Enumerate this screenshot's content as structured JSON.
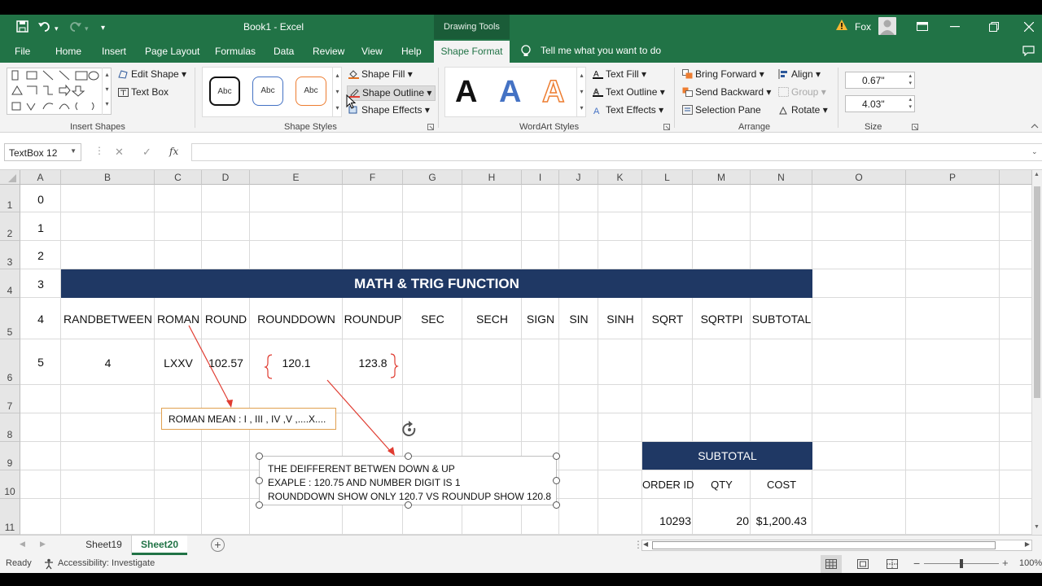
{
  "titlebar": {
    "title": "Book1  -  Excel",
    "contextual_group": "Drawing Tools",
    "user": "Fox",
    "customize_icon": "▾"
  },
  "tabs": {
    "file": "File",
    "home": "Home",
    "insert": "Insert",
    "page_layout": "Page Layout",
    "formulas": "Formulas",
    "data": "Data",
    "review": "Review",
    "view": "View",
    "help": "Help",
    "shape_format": "Shape Format",
    "tell_me": "Tell me what you want to do"
  },
  "ribbon": {
    "insert_shapes": {
      "label": "Insert Shapes",
      "edit_shape": "Edit Shape",
      "text_box": "Text Box"
    },
    "shape_styles": {
      "label": "Shape Styles",
      "sample": "Abc",
      "shape_fill": "Shape Fill",
      "shape_outline": "Shape Outline",
      "shape_effects": "Shape Effects"
    },
    "wordart_styles": {
      "label": "WordArt Styles",
      "letter": "A",
      "text_fill": "Text Fill",
      "text_outline": "Text Outline",
      "text_effects": "Text Effects"
    },
    "arrange": {
      "label": "Arrange",
      "bring_forward": "Bring Forward",
      "send_backward": "Send Backward",
      "selection_pane": "Selection Pane",
      "align": "Align",
      "group": "Group",
      "rotate": "Rotate"
    },
    "size": {
      "label": "Size",
      "height": "0.67\"",
      "width": "4.03\""
    }
  },
  "formula_bar": {
    "name_box": "TextBox 12",
    "cancel": "✕",
    "enter": "✓",
    "fx": "fx",
    "content": ""
  },
  "grid": {
    "columns": [
      "A",
      "B",
      "C",
      "D",
      "E",
      "F",
      "G",
      "H",
      "I",
      "J",
      "K",
      "L",
      "M",
      "N",
      "O",
      "P"
    ],
    "rows": [
      "1",
      "2",
      "3",
      "4",
      "5",
      "6",
      "7",
      "8",
      "9",
      "10",
      "11"
    ],
    "col_a": [
      "0",
      "1",
      "2",
      "3",
      "4",
      "5"
    ],
    "banner": "MATH & TRIG FUNCTION",
    "headers": [
      "RANDBETWEEN",
      "ROMAN",
      "ROUND",
      "ROUNDDOWN",
      "ROUNDUP",
      "SEC",
      "SECH",
      "SIGN",
      "SIN",
      "SINH",
      "SQRT",
      "SQRTPI",
      "SUBTOTAL"
    ],
    "values": {
      "randbetween": "4",
      "roman": "LXXV",
      "round": "102.57",
      "rounddown": "120.1",
      "roundup": "123.8"
    },
    "subtotal": {
      "title": "SUBTOTAL",
      "col1": "ORDER ID",
      "col2": "QTY",
      "col3": "COST",
      "order_id": "10293",
      "qty": "20",
      "cost": "$1,200.43"
    }
  },
  "textboxes": {
    "roman_note": "ROMAN MEAN : I , III , IV ,V ,....X....",
    "diff_line1": "THE DEIFFERENT BETWEN DOWN & UP",
    "diff_line2": "EXAPLE : 120.75 AND NUMBER DIGIT IS 1",
    "diff_line3": "ROUNDDOWN SHOW ONLY 120.7 VS ROUNDUP SHOW 120.8"
  },
  "sheets": {
    "tab1": "Sheet19",
    "tab2": "Sheet20",
    "add": "+"
  },
  "status": {
    "ready": "Ready",
    "accessibility": "Accessibility: Investigate",
    "zoom": "100%"
  },
  "colors": {
    "excel_green": "#217346",
    "banner_navy": "#1f3864",
    "arrow_red": "#e03c31"
  }
}
